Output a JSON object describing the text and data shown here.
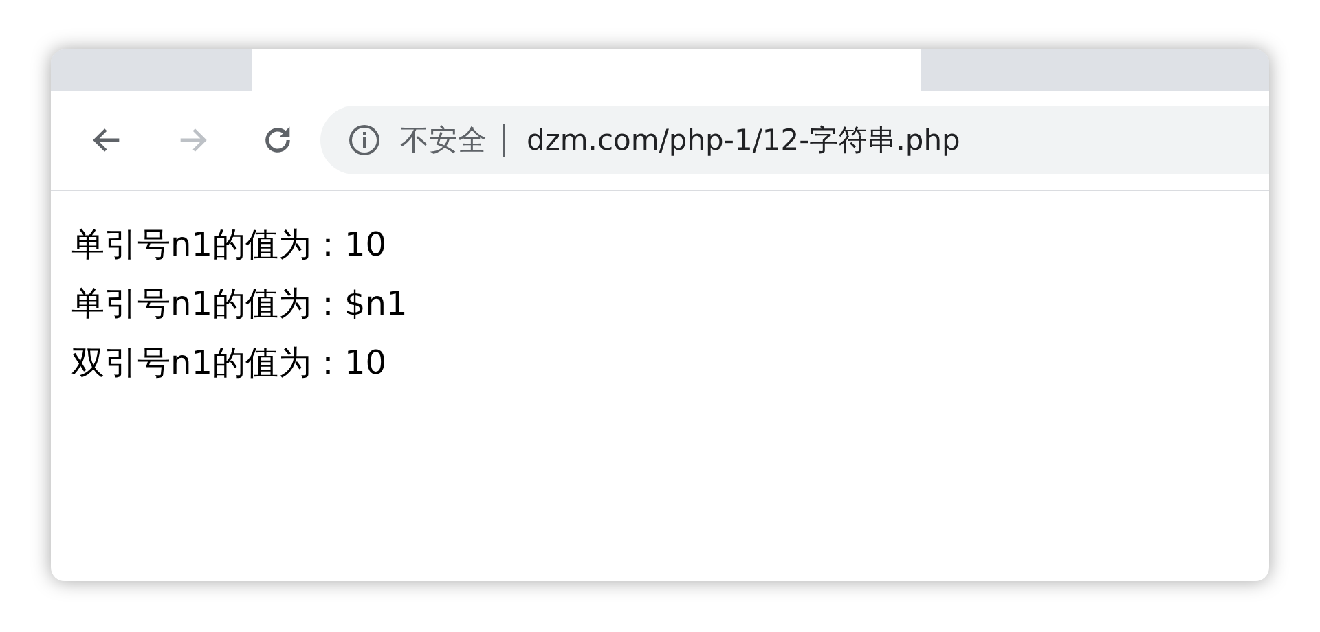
{
  "tabs": [
    {
      "selected": false
    },
    {
      "selected": true
    },
    {
      "selected": false
    }
  ],
  "address_bar": {
    "security_label": "不安全",
    "url": "dzm.com/php-1/12-字符串.php"
  },
  "content": {
    "lines": [
      "单引号n1的值为：10",
      "单引号n1的值为：$n1",
      "双引号n1的值为：10"
    ]
  }
}
